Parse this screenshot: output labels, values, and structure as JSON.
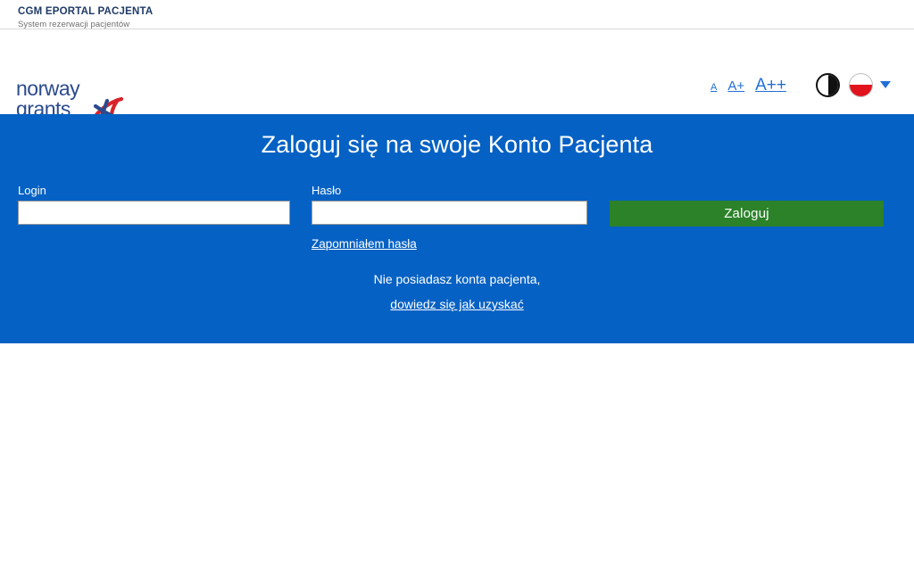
{
  "header": {
    "title": "CGM EPORTAL PACJENTA",
    "subtitle": "System rezerwacji pacjentów"
  },
  "brand": {
    "logo_line1": "norway",
    "logo_line2": "grants",
    "logo_name": "norway-grants-logo"
  },
  "toolbar": {
    "font_size_small": "A",
    "font_size_medium": "A+",
    "font_size_large": "A++",
    "contrast_icon": "contrast-icon",
    "language_flag_icon": "polish-flag-icon",
    "language_caret_icon": "chevron-down-icon"
  },
  "login": {
    "title": "Zaloguj się na swoje Konto Pacjenta",
    "login_label": "Login",
    "login_value": "",
    "login_placeholder": "",
    "password_label": "Hasło",
    "password_value": "",
    "password_placeholder": "",
    "submit_label": "Zaloguj",
    "forgot_password_label": "Zapomniałem hasła",
    "no_account_text": "Nie posiadasz konta pacjenta,",
    "no_account_link": "dowiedz się jak uzyskać"
  },
  "colors": {
    "panel_blue": "#0561c4",
    "button_green": "#2b8229",
    "link_blue": "#1f6fd6",
    "header_navy": "#1f3b66",
    "flag_red": "#e1141e",
    "logo_blue": "#2b4b8f",
    "logo_red": "#d8232a"
  }
}
